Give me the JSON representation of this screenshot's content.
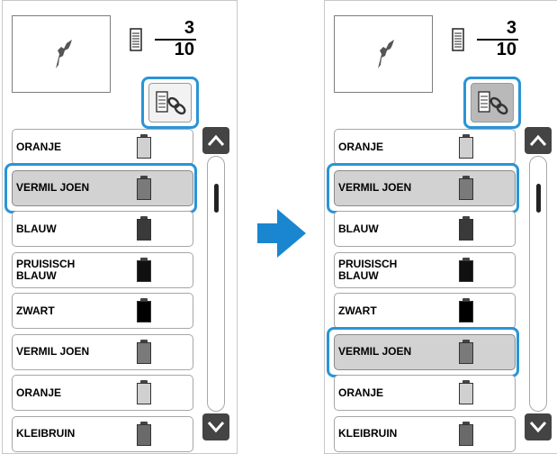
{
  "panels": [
    {
      "counter": {
        "current": "3",
        "total": "10"
      },
      "link_button_state": "normal",
      "threads": [
        {
          "label": "ORANJE",
          "color": "#d0d0d0"
        },
        {
          "label": "VERMIL JOEN",
          "color": "#7a7a7a"
        },
        {
          "label": "BLAUW",
          "color": "#3a3a3a"
        },
        {
          "label": "PRUISISCH\nBLAUW",
          "color": "#101010"
        },
        {
          "label": "ZWART",
          "color": "#000000"
        },
        {
          "label": "VERMIL JOEN",
          "color": "#7a7a7a"
        },
        {
          "label": "ORANJE",
          "color": "#d0d0d0"
        },
        {
          "label": "KLEIBRUIN",
          "color": "#6a6a6a"
        }
      ],
      "selected_rows": [
        1
      ]
    },
    {
      "counter": {
        "current": "3",
        "total": "10"
      },
      "link_button_state": "pressed",
      "threads": [
        {
          "label": "ORANJE",
          "color": "#d0d0d0"
        },
        {
          "label": "VERMIL JOEN",
          "color": "#7a7a7a"
        },
        {
          "label": "BLAUW",
          "color": "#3a3a3a"
        },
        {
          "label": "PRUISISCH\nBLAUW",
          "color": "#101010"
        },
        {
          "label": "ZWART",
          "color": "#000000"
        },
        {
          "label": "VERMIL JOEN",
          "color": "#7a7a7a"
        },
        {
          "label": "ORANJE",
          "color": "#d0d0d0"
        },
        {
          "label": "KLEIBRUIN",
          "color": "#6a6a6a"
        }
      ],
      "selected_rows": [
        1,
        5
      ]
    }
  ],
  "highlight_color": "#2a94d6",
  "transition_arrow_color": "#1a86d0",
  "icons": {
    "preview": "embroidery-shape-icon",
    "counter": "thread-spool-icon",
    "link": "thread-link-icon",
    "scroll_up": "chevron-up-icon",
    "scroll_down": "chevron-down-icon",
    "transition": "arrow-right-icon"
  }
}
